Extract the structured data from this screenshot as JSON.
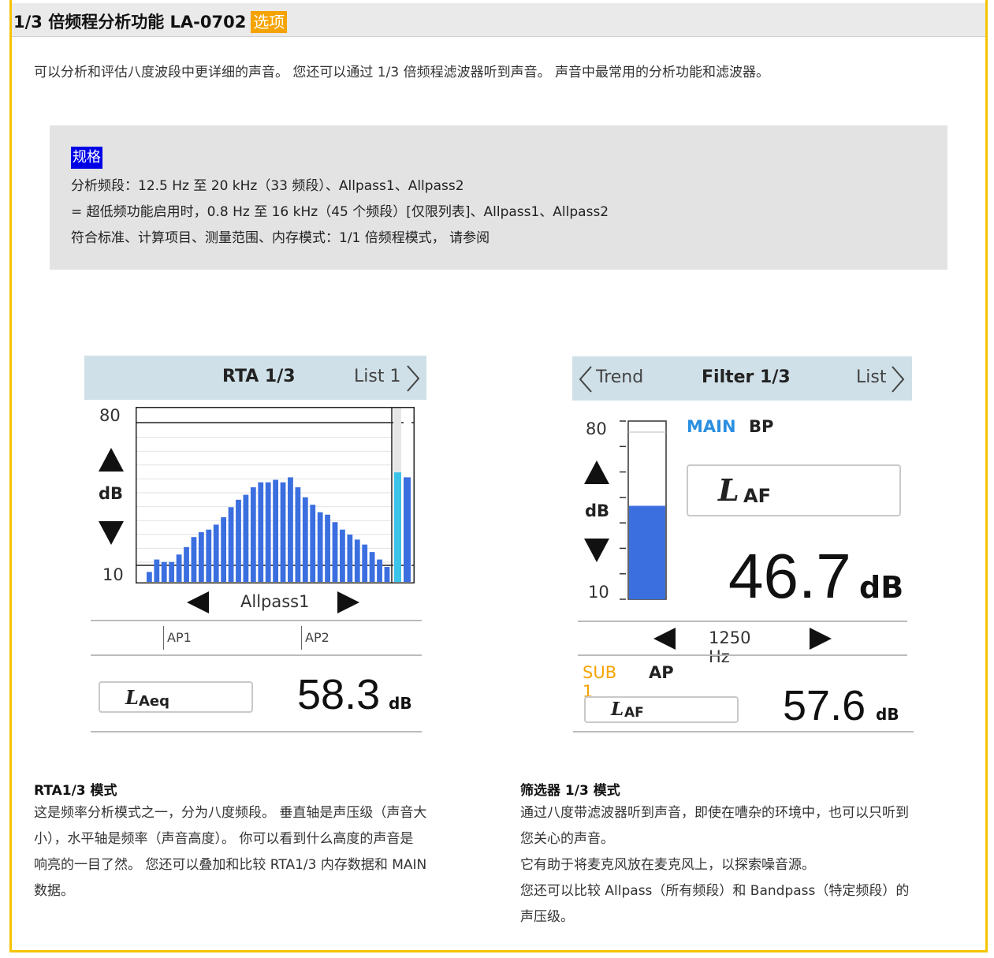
{
  "page": {
    "title": "1/3 倍频程分析功能 LA-0702",
    "title_badge": "选项",
    "intro": "可以分析和评估八度波段中更详细的声音。 您还可以通过 1/3 倍频程滤波器听到声音。 声音中最常用的分析功能和滤波器。"
  },
  "spec": {
    "tag": "规格",
    "lines": [
      "分析频段：12.5 Hz 至 20 kHz（33 频段）、Allpass1、Allpass2",
      "= 超低频功能启用时，0.8 Hz 至 16 kHz（45 个频段）[仅限列表]、Allpass1、Allpass2",
      "符合标准、计算项目、测量范围、内存模式：1/1 倍频程模式， 请参阅"
    ]
  },
  "rta_panel": {
    "title": "RTA 1/3",
    "nav_right": "List 1",
    "axis_top": "80",
    "axis_bottom": "10",
    "axis_unit": "dB",
    "selector": "Allpass1",
    "marker_1": "AP1",
    "marker_2": "AP2",
    "label_main": "L",
    "label_sub": "Aeq",
    "value": "58.3",
    "unit": "dB"
  },
  "filter_panel": {
    "nav_left": "Trend",
    "title": "Filter 1/3",
    "nav_right": "List",
    "axis_top": "80",
    "axis_bottom": "10",
    "axis_unit": "dB",
    "main_label": "MAIN",
    "main_mode": "BP",
    "label_main": "L",
    "label_sub": "AF",
    "value": "46.7",
    "unit": "dB",
    "frequency": "1250 Hz",
    "sub_label": "SUB 1",
    "sub_mode": "AP",
    "sub_label_main": "L",
    "sub_label_sub": "AF",
    "sub_value": "57.6",
    "sub_unit": "dB"
  },
  "colors": {
    "bar_blue": "#3b6fe0",
    "allpass_cyan": "#3cc3ea",
    "header_bg": "#cfe0e8",
    "main_blue": "#2a8fe0",
    "sub_orange": "#f5a300",
    "frame_yellow": "#f5c400"
  },
  "chart_data": {
    "type": "bar",
    "ylim": [
      10,
      80
    ],
    "values": [
      14,
      19,
      18,
      18,
      21,
      24,
      28,
      30,
      31,
      33,
      36,
      40,
      43,
      45,
      48,
      50,
      50,
      51,
      50,
      52,
      48,
      44,
      41,
      38,
      37,
      34,
      31,
      29,
      27,
      25,
      22,
      19,
      16
    ],
    "allpass": [
      54,
      52
    ]
  },
  "rta_desc": {
    "title": "RTA1/3 模式",
    "lines": [
      "这是频率分析模式之一，分为八度频段。 垂直轴是声压级（声音大",
      "小），水平轴是频率（声音高度）。 你可以看到什么高度的声音是",
      "响亮的一目了然。 您还可以叠加和比较 RTA1/3 内存数据和 MAIN",
      "数据。"
    ]
  },
  "filter_desc": {
    "title": "筛选器 1/3 模式",
    "lines": [
      "通过八度带滤波器听到声音，即使在嘈杂的环境中，也可以只听到",
      "您关心的声音。",
      "它有助于将麦克风放在麦克风上，以探索噪音源。",
      "您还可以比较 Allpass（所有频段）和 Bandpass（特定频段）的",
      "声压级。"
    ]
  }
}
